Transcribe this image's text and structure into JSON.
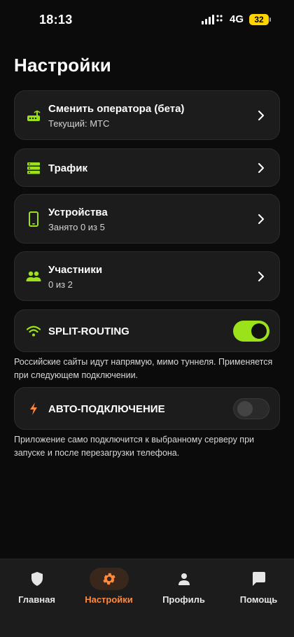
{
  "status_bar": {
    "time": "18:13",
    "network": "4G",
    "battery": "32"
  },
  "page": {
    "title": "Настройки"
  },
  "cards": {
    "operator": {
      "title": "Сменить оператора (бета)",
      "subtitle": "Текущий: МТС",
      "icon": "router-icon"
    },
    "traffic": {
      "title": "Трафик",
      "icon": "storage-list-icon"
    },
    "devices": {
      "title": "Устройства",
      "subtitle": "Занято 0 из 5",
      "icon": "smartphone-icon"
    },
    "members": {
      "title": "Участники",
      "subtitle": "0 из 2",
      "icon": "people-icon"
    },
    "split_routing": {
      "title": "SPLIT-ROUTING",
      "enabled": true,
      "icon": "wifi-icon",
      "hint": "Российские сайты идут напрямую, мимо туннеля. Применяется при следующем подключении."
    },
    "auto_connect": {
      "title": "АВТО-ПОДКЛЮЧЕНИЕ",
      "enabled": false,
      "icon": "lightning-icon",
      "hint": "Приложение само подключится к выбранному серверу при запуске и после перезагрузки телефона."
    }
  },
  "bottom_nav": {
    "items": [
      {
        "label": "Главная",
        "icon": "shield-icon",
        "active": false
      },
      {
        "label": "Настройки",
        "icon": "gear-icon",
        "active": true
      },
      {
        "label": "Профиль",
        "icon": "person-icon",
        "active": false
      },
      {
        "label": "Помощь",
        "icon": "chat-icon",
        "active": false
      }
    ]
  },
  "colors": {
    "accent_green": "#9be21a",
    "accent_orange": "#ff8a3d",
    "battery_yellow": "#ffd400"
  }
}
